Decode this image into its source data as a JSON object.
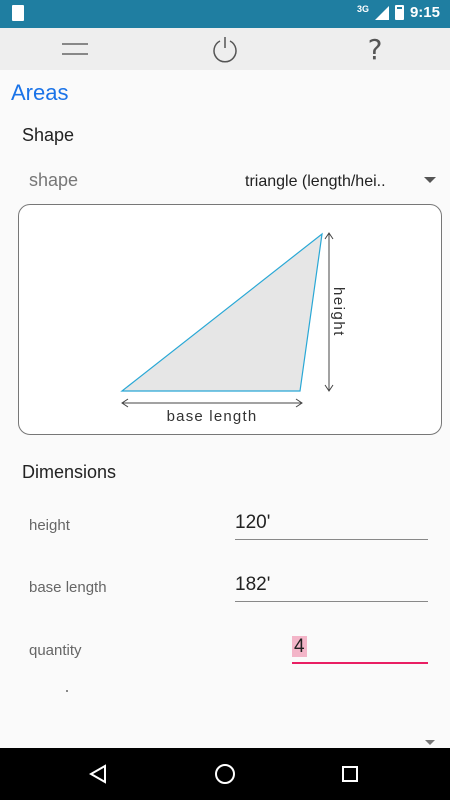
{
  "status_bar": {
    "network": "3G",
    "time": "9:15"
  },
  "toolbar": {
    "menu_icon": "hamburger-icon",
    "power_icon": "power-icon",
    "help_label": "?"
  },
  "page": {
    "title": "Areas"
  },
  "shape_section": {
    "heading": "Shape",
    "shape_label": "shape",
    "shape_value": "triangle (length/hei.."
  },
  "diagram": {
    "height_label": "height",
    "base_label": "base length"
  },
  "dimensions_section": {
    "heading": "Dimensions",
    "fields": [
      {
        "label": "height",
        "value": "120'"
      },
      {
        "label": "base length",
        "value": "182'"
      },
      {
        "label": "quantity",
        "value": "4"
      }
    ]
  },
  "colors": {
    "status_bar": "#1f7ea1",
    "accent": "#1a73e8",
    "active_field": "#e91e63",
    "triangle_stroke": "#29a8d6"
  }
}
